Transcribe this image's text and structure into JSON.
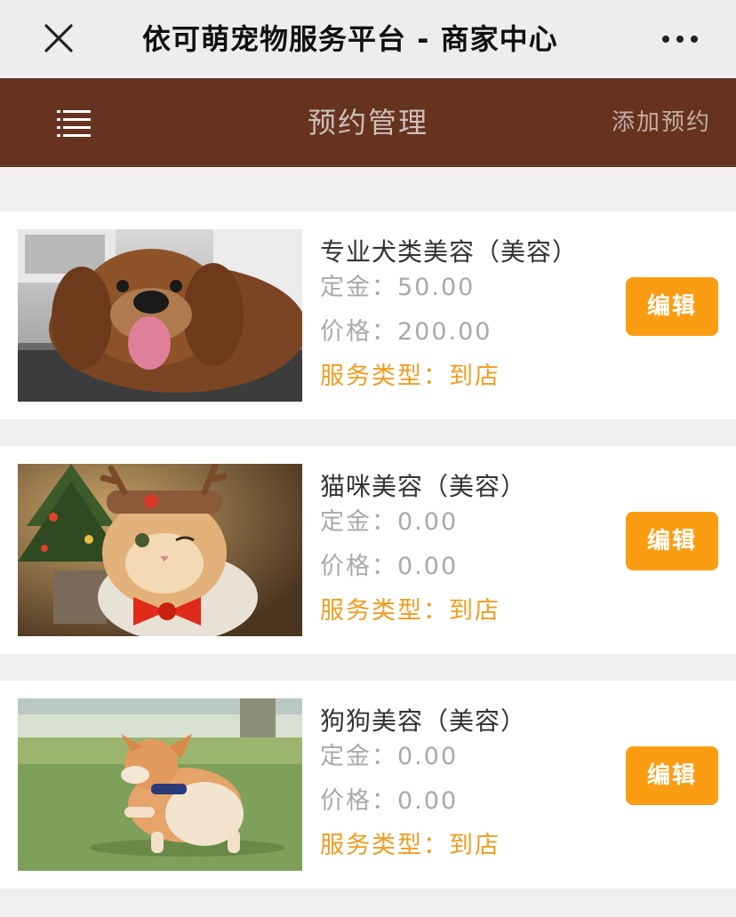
{
  "window": {
    "title": "依可萌宠物服务平台 - 商家中心"
  },
  "header": {
    "title": "预约管理",
    "add_label": "添加预约"
  },
  "labels": {
    "deposit": "定金：",
    "price": "价格：",
    "service_type": "服务类型："
  },
  "items": [
    {
      "name": "专业犬类美容（美容）",
      "deposit": "50.00",
      "price": "200.00",
      "service_type": "到店",
      "edit_label": "编辑",
      "image": "spaniel-in-bath"
    },
    {
      "name": "猫咪美容（美容）",
      "deposit": "0.00",
      "price": "0.00",
      "service_type": "到店",
      "edit_label": "编辑",
      "image": "cat-with-antlers"
    },
    {
      "name": "狗狗美容（美容）",
      "deposit": "0.00",
      "price": "0.00",
      "service_type": "到店",
      "edit_label": "编辑",
      "image": "corgi-on-grass"
    }
  ],
  "colors": {
    "header_bg": "#663320",
    "accent": "#fb9d12",
    "service_text": "#f29c1f",
    "muted_text": "#a9a9a9"
  },
  "icons": [
    "close-icon",
    "more-icon",
    "menu-icon"
  ]
}
